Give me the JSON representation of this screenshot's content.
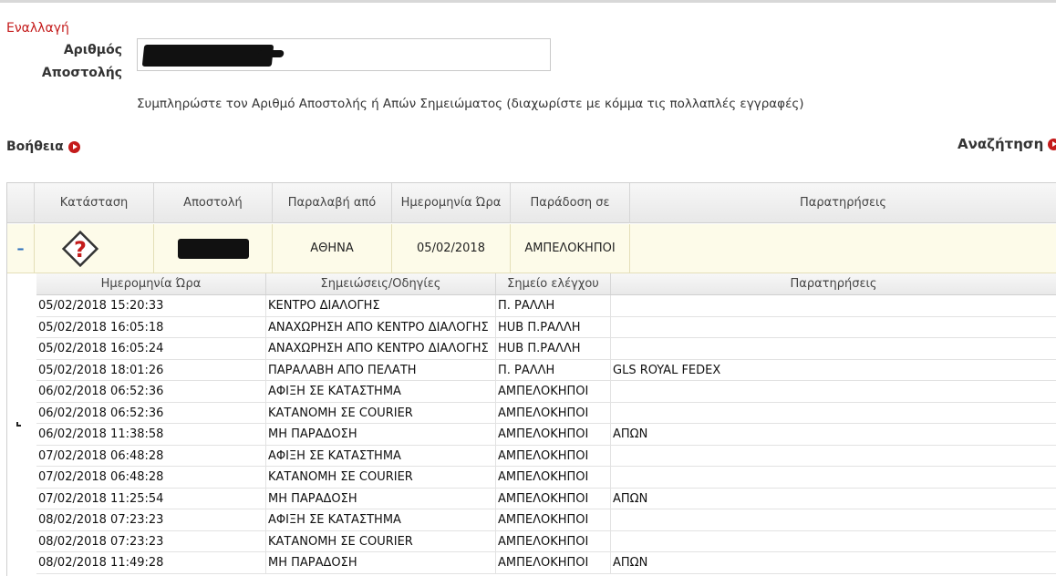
{
  "toggle_label": "Εναλλαγή",
  "form": {
    "label_line1": "Αριθμός",
    "label_line2": "Αποστολής",
    "input_value": "",
    "hint": "Συμπληρώστε τον Αριθμό Αποστολής ή Απών Σημειώματος (διαχωρίστε με κόμμα τις πολλαπλές εγγραφές)"
  },
  "help_label": "Βοήθεια",
  "search_label": "Αναζήτηση",
  "shipment_table": {
    "headers": [
      "Κατάσταση",
      "Αποστολή",
      "Παραλαβή από",
      "Ημερομηνία Ώρα",
      "Παράδοση σε",
      "Παρατηρήσεις"
    ],
    "row": {
      "expander": "–",
      "status_icon": "question-diamond-icon",
      "shipment": "",
      "pickup_from": "ΑΘΗΝΑ",
      "date": "05/02/2018",
      "delivery_to": "ΑΜΠΕΛΟΚΗΠΟΙ",
      "notes": ""
    }
  },
  "history_table": {
    "headers": [
      "Ημερομηνία Ώρα",
      "Σημειώσεις/Οδηγίες",
      "Σημείο ελέγχου",
      "Παρατηρήσεις"
    ],
    "rows": [
      [
        "05/02/2018 15:20:33",
        "ΚΕΝΤΡΟ ΔΙΑΛΟΓΗΣ",
        "Π. ΡΑΛΛΗ",
        ""
      ],
      [
        "05/02/2018 16:05:18",
        "ΑΝΑΧΩΡΗΣΗ ΑΠΟ ΚΕΝΤΡΟ ΔΙΑΛΟΓΗΣ",
        "HUB Π.ΡΑΛΛΗ",
        ""
      ],
      [
        "05/02/2018 16:05:24",
        "ΑΝΑΧΩΡΗΣΗ ΑΠΟ ΚΕΝΤΡΟ ΔΙΑΛΟΓΗΣ",
        "HUB Π.ΡΑΛΛΗ",
        ""
      ],
      [
        "05/02/2018 18:01:26",
        "ΠΑΡΑΛΑΒΗ ΑΠΟ ΠΕΛΑΤΗ",
        "Π. ΡΑΛΛΗ",
        "GLS ROYAL FEDEX"
      ],
      [
        "06/02/2018 06:52:36",
        "ΑΦΙΞΗ ΣΕ ΚΑΤΑΣΤΗΜΑ",
        "ΑΜΠΕΛΟΚΗΠΟΙ",
        ""
      ],
      [
        "06/02/2018 06:52:36",
        "ΚΑΤΑΝΟΜΗ ΣΕ COURIER",
        "ΑΜΠΕΛΟΚΗΠΟΙ",
        ""
      ],
      [
        "06/02/2018 11:38:58",
        "ΜΗ ΠΑΡΑΔΟΣΗ",
        "ΑΜΠΕΛΟΚΗΠΟΙ",
        "ΑΠΩΝ"
      ],
      [
        "07/02/2018 06:48:28",
        "ΑΦΙΞΗ ΣΕ ΚΑΤΑΣΤΗΜΑ",
        "ΑΜΠΕΛΟΚΗΠΟΙ",
        ""
      ],
      [
        "07/02/2018 06:48:28",
        "ΚΑΤΑΝΟΜΗ ΣΕ COURIER",
        "ΑΜΠΕΛΟΚΗΠΟΙ",
        ""
      ],
      [
        "07/02/2018 11:25:54",
        "ΜΗ ΠΑΡΑΔΟΣΗ",
        "ΑΜΠΕΛΟΚΗΠΟΙ",
        "ΑΠΩΝ"
      ],
      [
        "08/02/2018 07:23:23",
        "ΑΦΙΞΗ ΣΕ ΚΑΤΑΣΤΗΜΑ",
        "ΑΜΠΕΛΟΚΗΠΟΙ",
        ""
      ],
      [
        "08/02/2018 07:23:23",
        "ΚΑΤΑΝΟΜΗ ΣΕ COURIER",
        "ΑΜΠΕΛΟΚΗΠΟΙ",
        ""
      ],
      [
        "08/02/2018 11:49:28",
        "ΜΗ ΠΑΡΑΔΟΣΗ",
        "ΑΜΠΕΛΟΚΗΠΟΙ",
        "ΑΠΩΝ"
      ]
    ]
  },
  "colors": {
    "accent_red": "#c41b1b",
    "expander_blue": "#2a6ebb",
    "selected_row_bg": "#fdfbe9"
  }
}
